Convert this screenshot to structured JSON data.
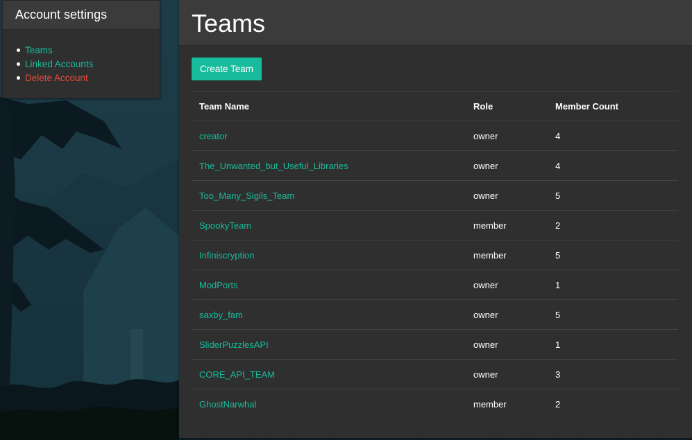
{
  "sidebar": {
    "title": "Account settings",
    "items": [
      {
        "label": "Teams",
        "color": "#18bc9c"
      },
      {
        "label": "Linked Accounts",
        "color": "#18bc9c"
      },
      {
        "label": "Delete Account",
        "color": "#e74c3c"
      }
    ]
  },
  "main": {
    "title": "Teams",
    "create_button_label": "Create Team",
    "table": {
      "headers": [
        "Team Name",
        "Role",
        "Member Count"
      ],
      "rows": [
        {
          "name": "creator",
          "role": "owner",
          "count": "4"
        },
        {
          "name": "The_Unwanted_but_Useful_Libraries",
          "role": "owner",
          "count": "4"
        },
        {
          "name": "Too_Many_Sigils_Team",
          "role": "owner",
          "count": "5"
        },
        {
          "name": "SpookyTeam",
          "role": "member",
          "count": "2"
        },
        {
          "name": "Infiniscryption",
          "role": "member",
          "count": "5"
        },
        {
          "name": "ModPorts",
          "role": "owner",
          "count": "1"
        },
        {
          "name": "saxby_fam",
          "role": "owner",
          "count": "5"
        },
        {
          "name": "SliderPuzzlesAPI",
          "role": "owner",
          "count": "1"
        },
        {
          "name": "CORE_API_TEAM",
          "role": "owner",
          "count": "3"
        },
        {
          "name": "GhostNarwhal",
          "role": "member",
          "count": "2"
        }
      ]
    }
  },
  "theme": {
    "accent": "#18bc9c",
    "danger": "#e74c3c",
    "panel": "#2f2f2f",
    "panel_header": "#3b3b3b"
  }
}
